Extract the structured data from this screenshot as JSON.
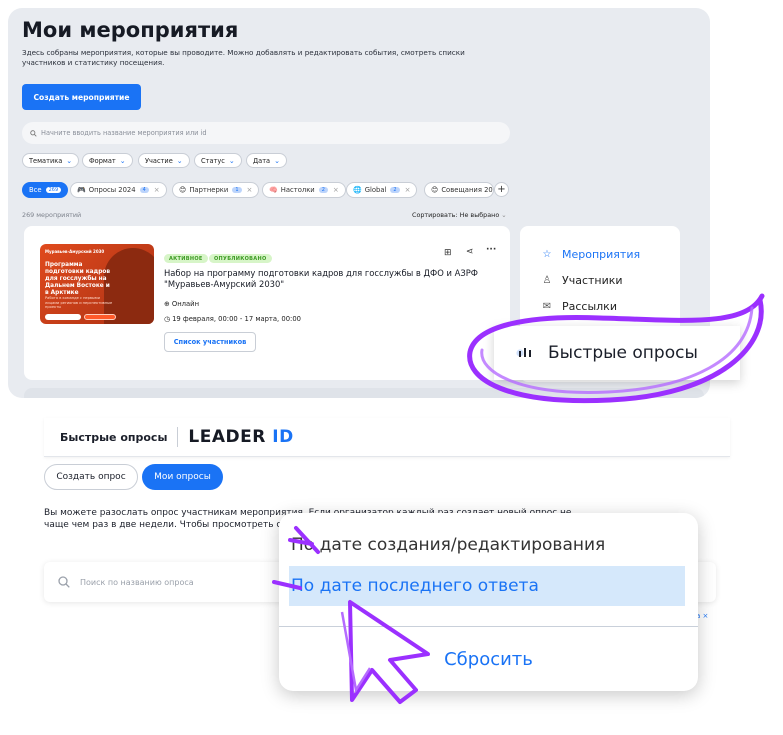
{
  "events": {
    "title": "Мои мероприятия",
    "description": "Здесь собраны мероприятия, которые вы проводите. Можно добавлять и редактировать события, смотреть списки участников и статистику посещения.",
    "create_button": "Создать мероприятие",
    "search_placeholder": "Начните вводить название мероприятия или id",
    "filters": [
      "Тематика",
      "Формат",
      "Участие",
      "Статус",
      "Дата"
    ],
    "tags": [
      {
        "label": "Все",
        "count": "269"
      },
      {
        "label": "Опросы 2024",
        "count": "4",
        "emoji": "🎮"
      },
      {
        "label": "Партнерки",
        "count": "1",
        "emoji": "😊"
      },
      {
        "label": "Настолки",
        "count": "2",
        "emoji": "🧠"
      },
      {
        "label": "Global",
        "count": "2",
        "emoji": "🌐"
      },
      {
        "label": "Совещания 20",
        "emoji": "😊"
      }
    ],
    "count_text": "269 мероприятий",
    "sort_label": "Сортировать:",
    "sort_value": "Не выбрано",
    "card": {
      "badge_active": "АКТИВНОЕ",
      "badge_published": "ОПУБЛИКОВАНО",
      "title": "Набор на программу подготовки кадров для госслужбы в ДФО и АЗРФ \"Муравьев-Амурский 2030\"",
      "format": "Онлайн",
      "date": "19 февраля, 00:00 - 17 марта, 00:00",
      "participants_button": "Список участников",
      "poster": {
        "logo": "Муравьев-Амурский 2030",
        "headline": "Программа подготовки кадров для госслужбы на Дальнем Востоке и в Арктике",
        "sub": "Работа в команде с первыми лицами регионов и перспективные проекты"
      }
    },
    "side_menu": [
      "Мероприятия",
      "Участники",
      "Рассылки"
    ]
  },
  "popout": {
    "label": "Быстрые опросы",
    "icon": "bar-chart-icon"
  },
  "surveys": {
    "title": "Быстрые опросы",
    "logo_main": "LEADER ",
    "logo_id": "ID",
    "tab_create": "Создать опрос",
    "tab_mine": "Мои опросы",
    "description": "Вы можете разослать опрос участникам мероприятия. Если организатор каждый раз создает новый опрос не чаще чем раз в две недели. Чтобы просмотреть статистику ответов.",
    "search_placeholder": "Поиск по названию опроса",
    "stray_reset": "а ×"
  },
  "sort_popup": {
    "option_created": "По дате создания/редактирования",
    "option_last_answer": "По дате последнего ответа",
    "reset": "Сбросить"
  },
  "colors": {
    "accent": "#1a73f5",
    "highlight": "#8a2be2"
  }
}
